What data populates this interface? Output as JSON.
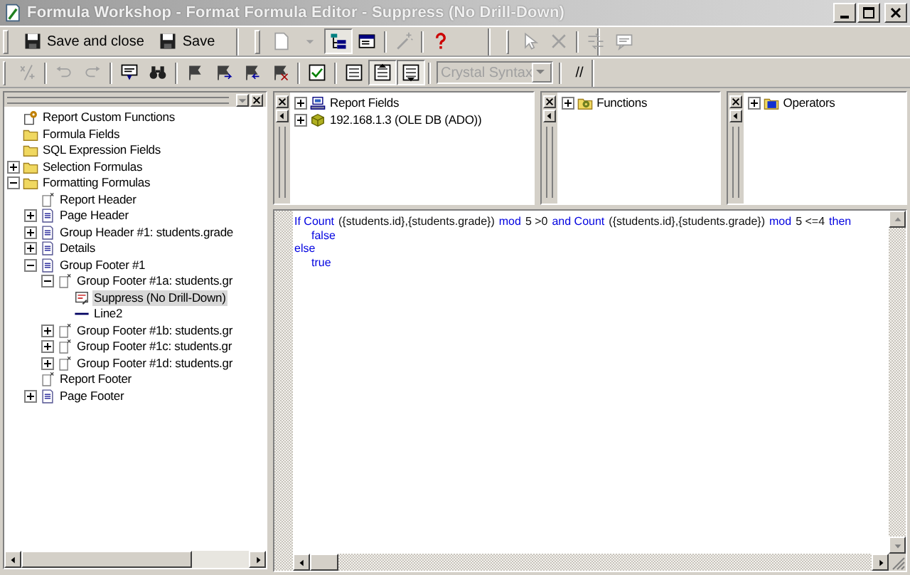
{
  "window": {
    "title": "Formula Workshop - Format Formula Editor - Suppress (No Drill-Down)"
  },
  "toolbar_rows": [
    {
      "bands": [
        {
          "items": [
            {
              "kind": "text",
              "label": "Save and close",
              "disabled": false,
              "pressed": false
            },
            {
              "kind": "text",
              "label": "Save",
              "disabled": false,
              "pressed": false
            }
          ]
        },
        {
          "items": [
            {
              "kind": "icon",
              "disabled": true,
              "pressed": false
            },
            {
              "kind": "icon",
              "disabled": true,
              "pressed": false
            },
            {
              "kind": "icon",
              "disabled": false,
              "pressed": true
            },
            {
              "kind": "icon",
              "disabled": false,
              "pressed": false
            },
            {
              "kind": "separator"
            },
            {
              "kind": "icon",
              "disabled": true,
              "pressed": false
            },
            {
              "kind": "separator"
            },
            {
              "kind": "icon",
              "disabled": false,
              "pressed": false
            }
          ]
        },
        {
          "items": [
            {
              "kind": "icon",
              "disabled": true,
              "pressed": false
            },
            {
              "kind": "icon",
              "disabled": true,
              "pressed": false
            },
            {
              "kind": "separator"
            },
            {
              "kind": "icon",
              "disabled": true,
              "pressed": false
            },
            {
              "kind": "icon",
              "disabled": true,
              "pressed": false
            }
          ]
        }
      ]
    },
    {
      "bands": [
        {
          "items": [
            {
              "kind": "icon",
              "disabled": true,
              "pressed": false
            },
            {
              "kind": "separator"
            },
            {
              "kind": "icon",
              "disabled": true,
              "pressed": false
            },
            {
              "kind": "icon",
              "disabled": true,
              "pressed": false
            },
            {
              "kind": "separator"
            },
            {
              "kind": "icon",
              "disabled": false,
              "pressed": false
            },
            {
              "kind": "icon",
              "disabled": false,
              "pressed": false
            },
            {
              "kind": "separator"
            },
            {
              "kind": "icon",
              "disabled": false,
              "pressed": false
            },
            {
              "kind": "icon",
              "disabled": false,
              "pressed": false
            },
            {
              "kind": "icon",
              "disabled": false,
              "pressed": false
            },
            {
              "kind": "icon",
              "disabled": false,
              "pressed": false
            },
            {
              "kind": "separator"
            },
            {
              "kind": "icon",
              "disabled": false,
              "pressed": false
            },
            {
              "kind": "separator"
            },
            {
              "kind": "icon",
              "disabled": false,
              "pressed": false
            },
            {
              "kind": "icon",
              "disabled": false,
              "pressed": true
            },
            {
              "kind": "icon",
              "disabled": false,
              "pressed": true
            },
            {
              "kind": "separator"
            },
            {
              "kind": "dropdown",
              "value": "Crystal Syntax",
              "disabled": true
            },
            {
              "kind": "separator"
            },
            {
              "kind": "text",
              "label": "//",
              "disabled": false,
              "pressed": false
            }
          ]
        }
      ]
    }
  ],
  "left_pane": {
    "tree": [
      {
        "label": "Report Custom Functions",
        "kind": "functions",
        "selected": false
      },
      {
        "label": "Formula Fields",
        "kind": "folder",
        "selected": false
      },
      {
        "label": "SQL Expression Fields",
        "kind": "folder",
        "selected": false
      },
      {
        "label": "Selection Formulas",
        "kind": "folder",
        "expanded": false,
        "selected": false
      },
      {
        "label": "Formatting Formulas",
        "kind": "folder",
        "expanded": true,
        "selected": false,
        "children": [
          {
            "label": "Report Header",
            "kind": "blank",
            "selected": false
          },
          {
            "label": "Page Header",
            "kind": "section",
            "expanded": false,
            "selected": false
          },
          {
            "label": "Group Header #1: students.grade",
            "kind": "section",
            "expanded": false,
            "selected": false
          },
          {
            "label": "Details",
            "kind": "section",
            "expanded": false,
            "selected": false
          },
          {
            "label": "Group Footer #1",
            "kind": "section",
            "expanded": true,
            "selected": false,
            "children": [
              {
                "label": "Group Footer #1a: students.gr",
                "kind": "blank",
                "expanded": true,
                "selected": false,
                "children": [
                  {
                    "label": "Suppress (No Drill-Down)",
                    "kind": "formula",
                    "selected": true
                  },
                  {
                    "label": "Line2",
                    "kind": "line",
                    "selected": false
                  }
                ]
              },
              {
                "label": "Group Footer #1b: students.gr",
                "kind": "blank",
                "expanded": false,
                "selected": false
              },
              {
                "label": "Group Footer #1c: students.gr",
                "kind": "blank",
                "expanded": false,
                "selected": false
              },
              {
                "label": "Group Footer #1d: students.gr",
                "kind": "blank",
                "expanded": false,
                "selected": false
              }
            ]
          },
          {
            "label": "Report Footer",
            "kind": "blank",
            "selected": false
          },
          {
            "label": "Page Footer",
            "kind": "section",
            "expanded": false,
            "selected": false
          }
        ]
      }
    ]
  },
  "top_panes": [
    {
      "tree": [
        {
          "label": "Report Fields",
          "kind": "computer",
          "expanded": false,
          "selected": false
        },
        {
          "label": "192.168.1.3 (OLE DB (ADO))",
          "kind": "database",
          "expanded": false,
          "selected": false
        }
      ]
    },
    {
      "tree": [
        {
          "label": "Functions",
          "kind": "library",
          "expanded": false,
          "selected": false
        }
      ]
    },
    {
      "tree": [
        {
          "label": "Operators",
          "kind": "operators",
          "expanded": false,
          "selected": false
        }
      ]
    }
  ],
  "editor": {
    "lines": [
      {
        "tokens": [
          {
            "kind": "keyword",
            "text": "If Count"
          },
          {
            "kind": "plain",
            "text": "({students.id},{students.grade})"
          },
          {
            "kind": "keyword",
            "text": "mod"
          },
          {
            "kind": "plain",
            "text": "5 >0"
          },
          {
            "kind": "keyword",
            "text": "and Count"
          },
          {
            "kind": "plain",
            "text": "({students.id},{students.grade})"
          },
          {
            "kind": "keyword",
            "text": "mod"
          },
          {
            "kind": "plain",
            "text": "5 <=4"
          },
          {
            "kind": "keyword",
            "text": "then"
          }
        ],
        "children": [
          {
            "tokens": [
              {
                "kind": "keyword",
                "text": "false"
              }
            ]
          }
        ]
      },
      {
        "tokens": [
          {
            "kind": "keyword",
            "text": "else"
          }
        ],
        "children": [
          {
            "tokens": [
              {
                "kind": "keyword",
                "text": "true"
              }
            ]
          }
        ]
      }
    ]
  }
}
